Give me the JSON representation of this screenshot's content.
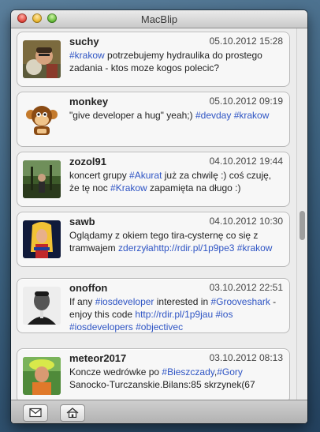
{
  "window": {
    "title": "MacBlip"
  },
  "posts": [
    {
      "username": "suchy",
      "timestamp": "05.10.2012 15:28",
      "segments": [
        {
          "t": "#krakow",
          "tag": true
        },
        {
          "t": " potrzebujemy hydraulika do prostego zadania - ktos moze kogos polecic?"
        }
      ]
    },
    {
      "username": "monkey",
      "timestamp": "05.10.2012 09:19",
      "segments": [
        {
          "t": "\"give developer a hug\" yeah;) "
        },
        {
          "t": "#devday",
          "tag": true
        },
        {
          "t": " "
        },
        {
          "t": "#krakow",
          "tag": true
        }
      ]
    },
    {
      "username": "zozol91",
      "timestamp": "04.10.2012 19:44",
      "segments": [
        {
          "t": "koncert grupy "
        },
        {
          "t": "#Akurat",
          "tag": true
        },
        {
          "t": " już za chwilę :) coś czuję, że tę noc "
        },
        {
          "t": "#Krakow",
          "tag": true
        },
        {
          "t": " zapamięta na długo :)"
        }
      ]
    },
    {
      "username": "sawb",
      "timestamp": "04.10.2012 10:30",
      "segments": [
        {
          "t": "Oglądamy z okiem tego tira-cysternę co się z tramwajem "
        },
        {
          "t": "zderzyłahttp://rdir.pl/1p9pe3",
          "tag": true
        },
        {
          "t": " "
        },
        {
          "t": "#krakow",
          "tag": true
        }
      ]
    },
    {
      "username": "onoffon",
      "timestamp": "03.10.2012 22:51",
      "segments": [
        {
          "t": "If any "
        },
        {
          "t": "#iosdeveloper",
          "tag": true
        },
        {
          "t": " interested in "
        },
        {
          "t": "#Grooveshark",
          "tag": true
        },
        {
          "t": " - enjoy this code "
        },
        {
          "t": "http://rdir.pl/1p9jau",
          "tag": true
        },
        {
          "t": " "
        },
        {
          "t": "#ios",
          "tag": true
        },
        {
          "t": " "
        },
        {
          "t": "#iosdevelopers",
          "tag": true
        },
        {
          "t": " "
        },
        {
          "t": "#objectivec",
          "tag": true
        }
      ]
    },
    {
      "username": "meteor2017",
      "timestamp": "03.10.2012 08:13",
      "segments": [
        {
          "t": "Koncze wedrówke po "
        },
        {
          "t": "#Bieszczady",
          "tag": true
        },
        {
          "t": ","
        },
        {
          "t": "#Gory",
          "tag": true
        },
        {
          "t": " Sanocko-Turczanskie.Bilans:85 skrzynek(67"
        }
      ]
    }
  ],
  "toolbar": {
    "buttons": [
      {
        "icon": "envelope-icon"
      },
      {
        "icon": "home-icon"
      }
    ]
  },
  "colors": {
    "hashtag": "#2f55c4",
    "card_background": "#f7f7f7",
    "window_background": "#ececec"
  }
}
